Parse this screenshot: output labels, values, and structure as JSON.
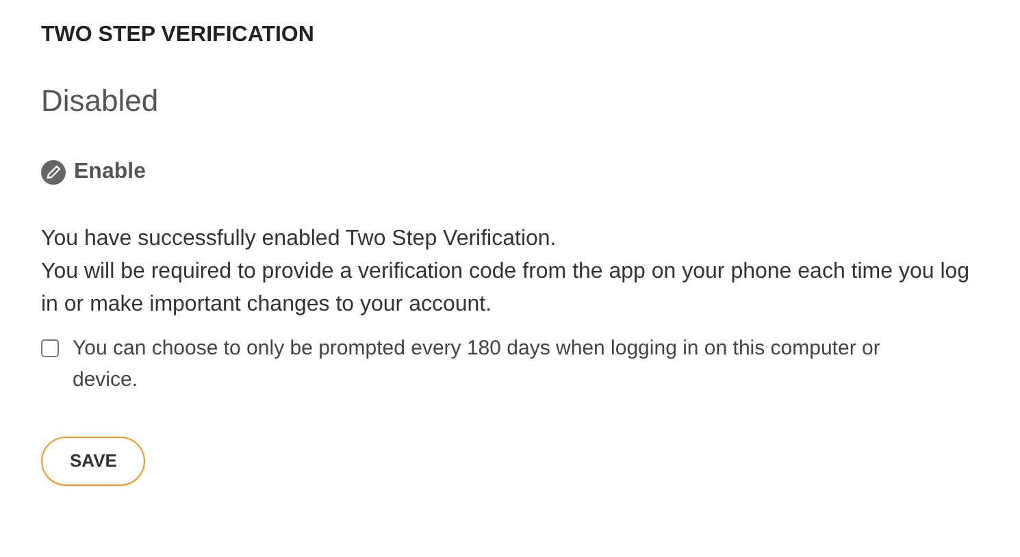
{
  "heading": "TWO STEP VERIFICATION",
  "status": "Disabled",
  "enable_link": "Enable",
  "messages": [
    "You have successfully enabled Two Step Verification.",
    "You will be required to provide a verification code from the app on your phone each time you log in or make important changes to your account."
  ],
  "remember_option": {
    "label": "You can choose to only be prompted every 180 days when logging in on this computer or device.",
    "checked": false
  },
  "buttons": [
    "SAVE"
  ]
}
